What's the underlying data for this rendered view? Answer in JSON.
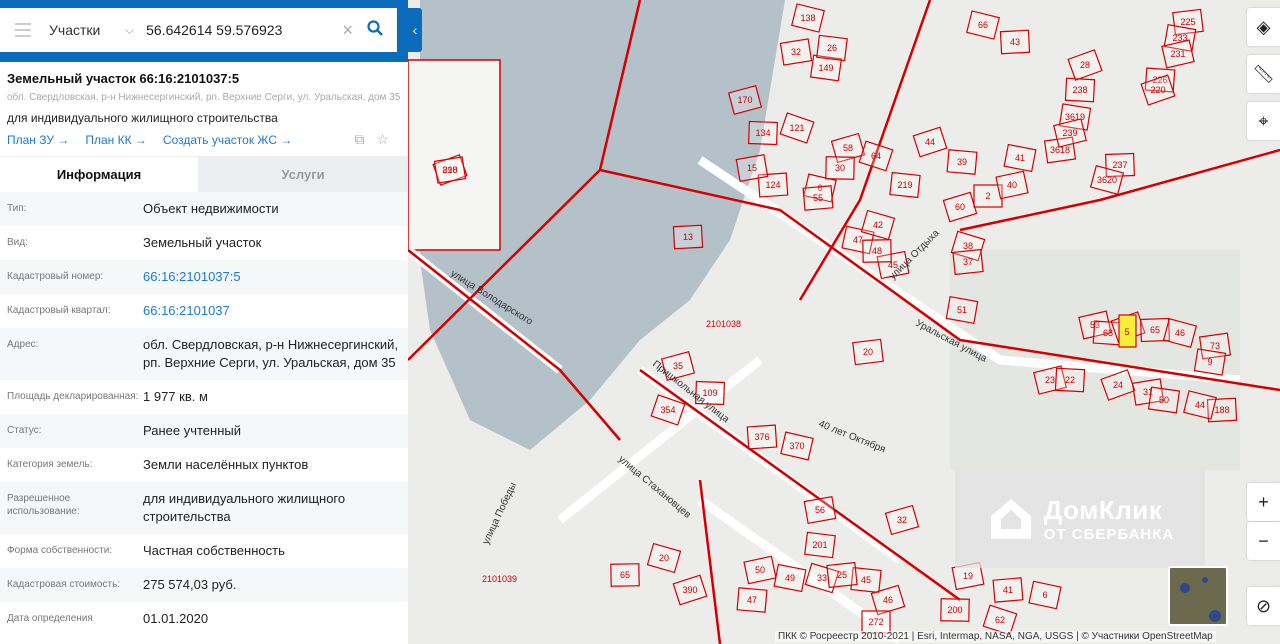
{
  "search": {
    "category": "Участки",
    "query": "56.642614 59.576923"
  },
  "object": {
    "title": "Земельный участок 66:16:2101037:5",
    "address": "обл. Свердловская, р-н Нижнесергинский, рп. Верхние Серги, ул. Уральская, дом 35",
    "purpose": "для индивидуального жилищного строительства",
    "links": [
      "План ЗУ →",
      "План КК →",
      "Создать участок ЖС →"
    ]
  },
  "tabs": [
    "Информация",
    "Услуги"
  ],
  "info": [
    {
      "label": "Тип:",
      "value": "Объект недвижимости"
    },
    {
      "label": "Вид:",
      "value": "Земельный участок"
    },
    {
      "label": "Кадастровый номер:",
      "value": "66:16:2101037:5",
      "link": true
    },
    {
      "label": "Кадастровый квартал:",
      "value": "66:16:2101037",
      "link": true
    },
    {
      "label": "Адрес:",
      "value": "обл. Свердловская, р-н Нижнесергинский, рп. Верхние Серги, ул. Уральская, дом 35"
    },
    {
      "label": "Площадь декларированная:",
      "value": "1 977 кв. м"
    },
    {
      "label": "Статус:",
      "value": "Ранее учтенный"
    },
    {
      "label": "Категория земель:",
      "value": "Земли населённых пунктов"
    },
    {
      "label": "Разрешенное использование:",
      "value": "для индивидуального жилищного строительства"
    },
    {
      "label": "Форма собственности:",
      "value": "Частная собственность"
    },
    {
      "label": "Кадастровая стоимость:",
      "value": "275 574,03 руб."
    },
    {
      "label": "Дата определения",
      "value": "01.01.2020"
    }
  ],
  "map": {
    "streets": [
      "улица Володарского",
      "Уральская улица",
      "Пришкольная улица",
      "улица Стахановцев",
      "40 лет Октября",
      "улица Победы",
      "улица Отдыха"
    ],
    "quarters": [
      "2101038",
      "2101039"
    ],
    "parcels": [
      "890",
      "13",
      "138",
      "32",
      "149",
      "170",
      "134",
      "121",
      "124",
      "6",
      "15",
      "26",
      "58",
      "30",
      "64",
      "55",
      "47",
      "45",
      "219",
      "60",
      "2",
      "38",
      "37",
      "41",
      "40",
      "39",
      "44",
      "48",
      "42",
      "20",
      "51",
      "53",
      "68",
      "5",
      "65",
      "46",
      "73",
      "9",
      "23",
      "22",
      "24",
      "188",
      "44",
      "31",
      "50",
      "35",
      "109",
      "354",
      "376",
      "370",
      "56",
      "201",
      "32",
      "200",
      "62",
      "41",
      "6",
      "19",
      "45",
      "46",
      "272",
      "33",
      "25",
      "49",
      "50",
      "47",
      "390",
      "65",
      "20",
      "225",
      "233",
      "231",
      "226",
      "220",
      "237",
      "3620",
      "3618",
      "3619",
      "239",
      "238",
      "28",
      "43",
      "66",
      "218"
    ],
    "highlight_parcel": "5",
    "highlight_color": "#f5ef3a",
    "parcel_color": "#d40000"
  },
  "watermark": {
    "brand": "ДомКлик",
    "sub": "ОТ СБЕРБАНКА"
  },
  "attribution": "ПКК © Росреестр 2010-2021 | Esri, Intermap, NASA, NGA, USGS | © Участники OpenStreetMap"
}
